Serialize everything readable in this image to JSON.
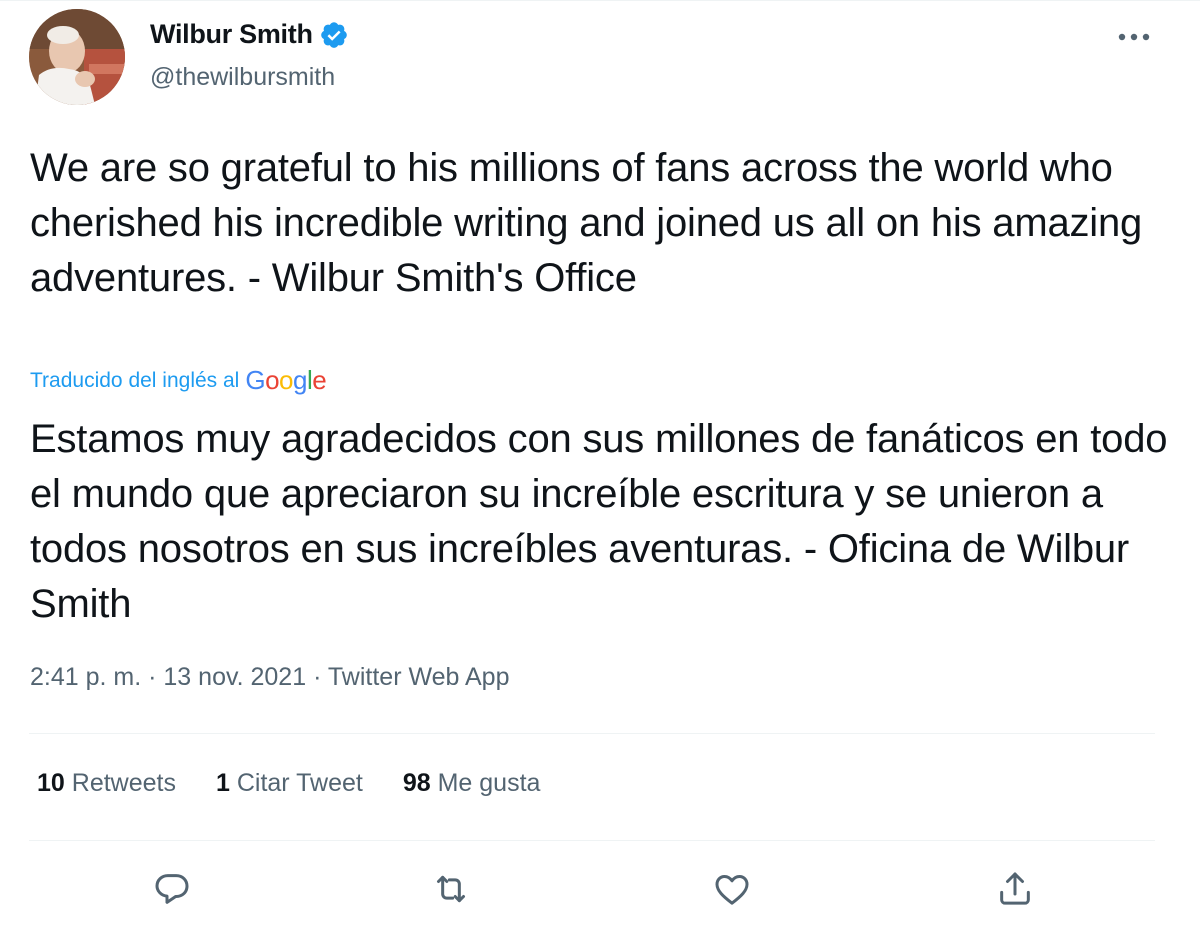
{
  "author": {
    "name": "Wilbur Smith",
    "handle": "@thewilbursmith"
  },
  "tweet": {
    "text": "We are so grateful to his millions of fans across the world who cherished his incredible writing and joined us all on his amazing adventures. - Wilbur Smith's Office",
    "translated_label": "Traducido del inglés al",
    "translated_provider": "Google",
    "translation": "Estamos muy agradecidos con sus millones de fanáticos en todo el mundo que apreciaron su increíble escritura y se unieron a todos nosotros en sus increíbles aventuras. - Oficina de Wilbur Smith",
    "time": "2:41 p. m.",
    "date": "13 nov. 2021",
    "source": "Twitter Web App",
    "separator": "·"
  },
  "stats": {
    "retweets_count": "10",
    "retweets_label": "Retweets",
    "quotes_count": "1",
    "quotes_label": "Citar Tweet",
    "likes_count": "98",
    "likes_label": "Me gusta"
  },
  "actions": [
    {
      "icon": "reply-icon"
    },
    {
      "icon": "retweet-icon"
    },
    {
      "icon": "like-icon"
    },
    {
      "icon": "share-icon"
    }
  ],
  "colors": {
    "verified": "#1d9bf0",
    "link": "#1d9bf0",
    "muted": "#536471",
    "text": "#0f1419",
    "divider": "#eff3f4"
  }
}
